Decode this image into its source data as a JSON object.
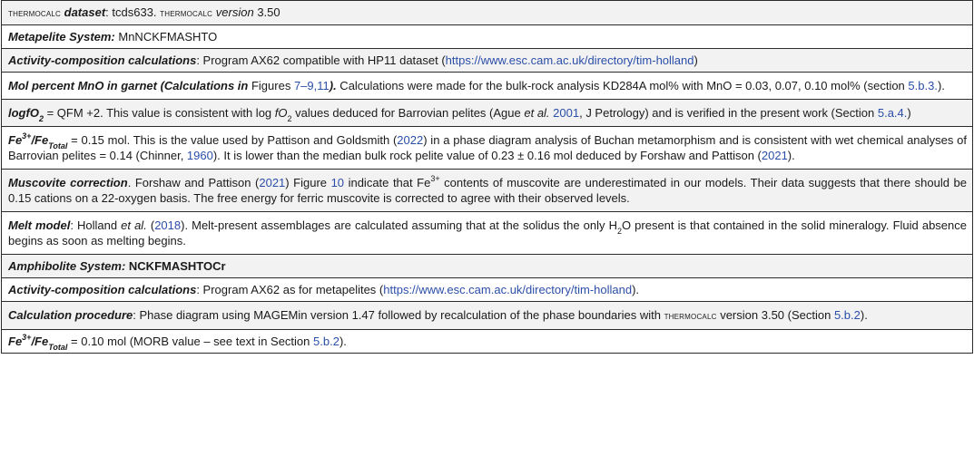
{
  "rows": [
    {
      "program_name": "thermocalc",
      "dataset_label": "dataset",
      "dataset_value": ": tcds633. ",
      "program_name2": "thermocalc",
      "version_label": "version",
      "version_value": " 3.50"
    },
    {
      "label": "Metapelite System:",
      "value": " MnNCKFMASHTO"
    },
    {
      "label": "Activity-composition calculations",
      "text_before": ": Program AX62 compatible with HP11 dataset (",
      "link": "https://www.esc.cam.ac.uk/directory/tim-holland",
      "text_after": ")"
    },
    {
      "label": "Mol percent MnO in garnet (Calculations in",
      "figures_word": " Figures ",
      "fig_link": "7–9,11",
      "label_end": ").",
      "text": " Calculations were made for the bulk-rock analysis KD284A mol% with MnO = 0.03, 0.07, 0.10 mol% (section ",
      "section_link": "5.b.3.",
      "text_end": ")."
    },
    {
      "label": "logfO",
      "label_sub": "2",
      "text1": " = QFM +2. This value is consistent with log ",
      "f_italic": "fO",
      "f_sub": "2",
      "text2": " values deduced for Barrovian pelites (Ague ",
      "et_al": "et al.",
      "year_link": "2001",
      "text3": ", J Petrology) and is verified in the present work (Section ",
      "section_link": "5.a.4.",
      "text_end": ")"
    },
    {
      "label_fe": "Fe",
      "label_sup": "3+",
      "label_slash_fe": "/Fe",
      "label_sub": "Total",
      "text1": " = 0.15 mol. This is the value used by Pattison and Goldsmith (",
      "link1": "2022",
      "text2": ") in a phase diagram analysis of Buchan metamorphism and is consistent with wet chemical analyses of Barrovian pelites = 0.14 (Chinner, ",
      "link2": "1960",
      "text3": "). It is lower than the median bulk rock pelite value of 0.23 ± 0.16 mol deduced by Forshaw and Pattison (",
      "link3": "2021",
      "text_end": ")."
    },
    {
      "label": "Muscovite correction",
      "text1": ". Forshaw and Pattison (",
      "link1": "2021",
      "text2": ") Figure ",
      "link2": "10",
      "text3": " indicate that Fe",
      "sup": "3+",
      "text4": " contents of muscovite are underestimated in our models. Their data suggests that there should be 0.15 cations on a 22-oxygen basis. The free energy for ferric muscovite is corrected to agree with their observed levels."
    },
    {
      "label": "Melt model",
      "text1": ": Holland ",
      "et_al": "et al.",
      "text2": " (",
      "link1": "2018",
      "text3": "). Melt-present assemblages are calculated assuming that at the solidus the only H",
      "sub": "2",
      "text4": "O present is that contained in the solid mineralogy. Fluid absence begins as soon as melting begins."
    },
    {
      "label": "Amphibolite System:",
      "value": " NCKFMASHTOCr"
    },
    {
      "label": "Activity-composition calculations",
      "text_before": ": Program AX62 as for metapelites (",
      "link": "https://www.esc.cam.ac.uk/directory/tim-holland",
      "text_after": ")."
    },
    {
      "label": "Calculation procedure",
      "text1": ": Phase diagram using MAGEMin version 1.47 followed by recalculation of the phase boundaries with ",
      "program_name": "thermocalc",
      "text2": " version 3.50 (Section ",
      "link": "5.b.2",
      "text_end": ")."
    },
    {
      "label_fe": "Fe",
      "label_sup": "3+",
      "label_slash_fe": "/Fe",
      "label_sub": "Total",
      "text1": " = 0.10 mol (MORB value – see text in Section ",
      "link": "5.b.2",
      "text_end": ")."
    }
  ],
  "colors": {
    "shaded_row": "#f2f2f2",
    "link": "#2b4ea8",
    "border": "#2b2b2b"
  }
}
